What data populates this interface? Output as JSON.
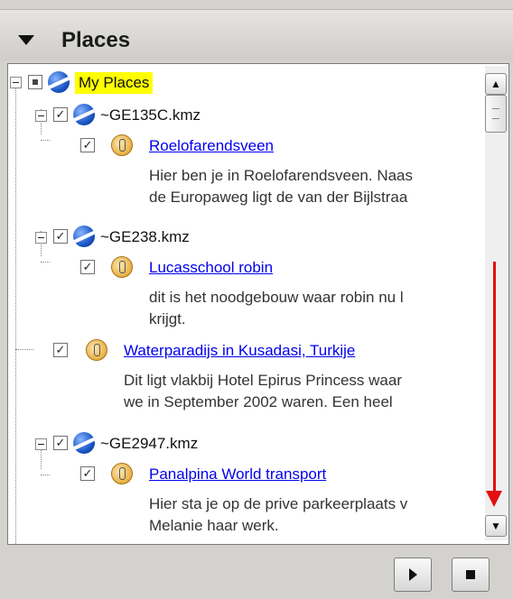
{
  "panel": {
    "title": "Places"
  },
  "tree": {
    "root": {
      "label": "My Places"
    },
    "items": [
      {
        "label": "~GE135C.kmz",
        "checked": true
      },
      {
        "label": "Roelofarendsveen",
        "checked": true,
        "desc": [
          "Hier ben je in Roelofarendsveen. Naas",
          "de Europaweg ligt de van der Bijlstraa"
        ]
      },
      {
        "label": "~GE238.kmz",
        "checked": true
      },
      {
        "label": "Lucasschool robin",
        "checked": true,
        "desc": [
          "dit is het noodgebouw waar robin nu l",
          "krijgt."
        ]
      },
      {
        "label": "Waterparadijs in Kusadasi, Turkije",
        "checked": true,
        "desc": [
          "Dit ligt vlakbij Hotel Epirus Princess waar",
          "we in September 2002 waren. Een heel"
        ]
      },
      {
        "label": "~GE2947.kmz",
        "checked": true
      },
      {
        "label": "Panalpina World transport",
        "checked": true,
        "desc": [
          "Hier sta je op de prive parkeerplaats v",
          "Melanie haar werk."
        ]
      }
    ],
    "check_glyph": "✓"
  },
  "scrollbar": {
    "up_icon": "▲",
    "down_icon": "▼"
  },
  "colors": {
    "highlight": "#ffff00",
    "link": "#0000ee",
    "annotation_arrow": "#e01010"
  }
}
